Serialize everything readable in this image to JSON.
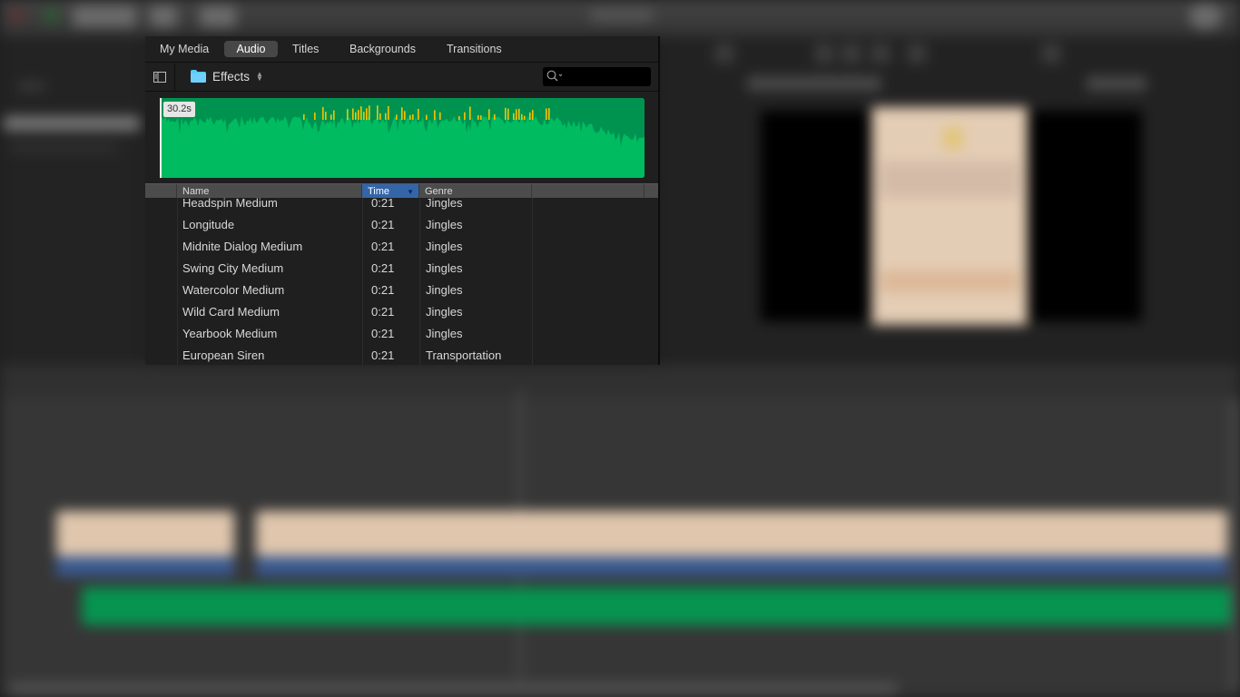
{
  "window": {
    "traffic_lights": [
      "close",
      "minimize",
      "zoom"
    ]
  },
  "browser": {
    "tabs": [
      {
        "label": "My Media",
        "active": false
      },
      {
        "label": "Audio",
        "active": true
      },
      {
        "label": "Titles",
        "active": false
      },
      {
        "label": "Backgrounds",
        "active": false
      },
      {
        "label": "Transitions",
        "active": false
      }
    ],
    "source": {
      "icon": "folder-icon",
      "label": "Effects",
      "folder_color": "#5ac8fa"
    },
    "search": {
      "value": "",
      "placeholder": ""
    },
    "preview": {
      "duration": "30.2s",
      "waveform_color": "#00bb60",
      "waveform_dark_color": "#009350",
      "peak_color": "#f5c400"
    },
    "table": {
      "columns": [
        {
          "label": "Name",
          "sorted": false
        },
        {
          "label": "Time",
          "sorted": true,
          "sort_direction": "descending"
        },
        {
          "label": "Genre",
          "sorted": false
        },
        {
          "label": "",
          "sorted": false
        }
      ],
      "rows": [
        {
          "name": "Headspin Medium",
          "time": "0:21",
          "genre": "Jingles"
        },
        {
          "name": "Longitude",
          "time": "0:21",
          "genre": "Jingles"
        },
        {
          "name": "Midnite Dialog Medium",
          "time": "0:21",
          "genre": "Jingles"
        },
        {
          "name": "Swing City Medium",
          "time": "0:21",
          "genre": "Jingles"
        },
        {
          "name": "Watercolor Medium",
          "time": "0:21",
          "genre": "Jingles"
        },
        {
          "name": "Wild Card Medium",
          "time": "0:21",
          "genre": "Jingles"
        },
        {
          "name": "Yearbook Medium",
          "time": "0:21",
          "genre": "Jingles"
        },
        {
          "name": "European Siren",
          "time": "0:21",
          "genre": "Transportation"
        }
      ]
    }
  },
  "timeline": {
    "clip_colors": {
      "video": "#dfc6ad",
      "title": "#3a5a90",
      "audio": "#069450"
    }
  }
}
